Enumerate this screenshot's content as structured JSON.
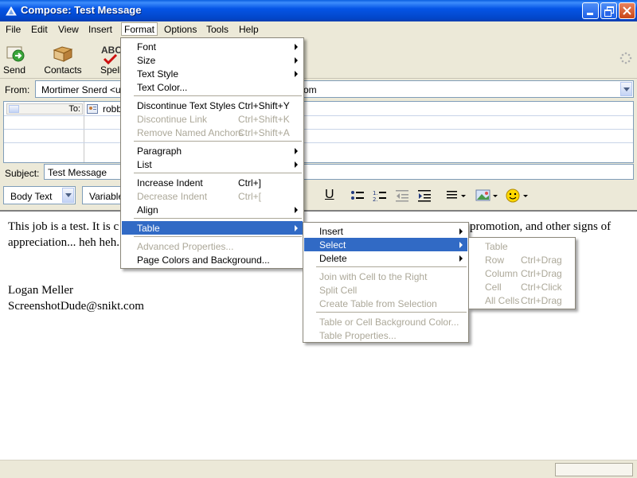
{
  "window": {
    "title": "Compose: Test Message"
  },
  "menubar": [
    "File",
    "Edit",
    "View",
    "Insert",
    "Format",
    "Options",
    "Tools",
    "Help"
  ],
  "toolbar": {
    "send": "Send",
    "contacts": "Contacts",
    "spell": "Spell",
    "spell_icon_text": "ABC"
  },
  "from": {
    "label": "From:",
    "value": "Mortimer Snerd <us",
    "value_tail": "om"
  },
  "to": {
    "label": "To:",
    "value": "robb"
  },
  "subject": {
    "label": "Subject:",
    "value": "Test Message"
  },
  "format_bar": {
    "paragraph_style": "Body Text",
    "font": "Variable",
    "underline": "U"
  },
  "body_lines": [
    "This job is a test.  It is c",
    "appreciation... heh heh.",
    "Logan Meller",
    "ScreenshotDude@snikt.com"
  ],
  "body_right": "promotion, and other signs of",
  "format_menu": [
    {
      "label": "Font",
      "submenu": true
    },
    {
      "label": "Size",
      "submenu": true
    },
    {
      "label": "Text Style",
      "submenu": true
    },
    {
      "label": "Text Color...",
      "submenu": false
    },
    {
      "label": "Discontinue Text Styles",
      "shortcut": "Ctrl+Shift+Y"
    },
    {
      "label": "Discontinue Link",
      "shortcut": "Ctrl+Shift+K",
      "disabled": true
    },
    {
      "label": "Remove Named Anchors",
      "shortcut": "Ctrl+Shift+A",
      "disabled": true
    },
    {
      "label": "Paragraph",
      "submenu": true
    },
    {
      "label": "List",
      "submenu": true
    },
    {
      "label": "Increase Indent",
      "shortcut": "Ctrl+]"
    },
    {
      "label": "Decrease Indent",
      "shortcut": "Ctrl+[",
      "disabled": true
    },
    {
      "label": "Align",
      "submenu": true
    },
    {
      "label": "Table",
      "submenu": true,
      "highlighted": true
    },
    {
      "label": "Advanced Properties...",
      "disabled": true
    },
    {
      "label": "Page Colors and Background..."
    }
  ],
  "table_menu": [
    {
      "label": "Insert",
      "submenu": true
    },
    {
      "label": "Select",
      "submenu": true,
      "highlighted": true
    },
    {
      "label": "Delete",
      "submenu": true
    },
    {
      "label": "Join with Cell to the Right",
      "disabled": true
    },
    {
      "label": "Split Cell",
      "disabled": true
    },
    {
      "label": "Create Table from Selection",
      "disabled": true
    },
    {
      "label": "Table or Cell Background Color...",
      "disabled": true
    },
    {
      "label": "Table Properties...",
      "disabled": true
    }
  ],
  "select_menu": [
    {
      "label": "Table",
      "shortcut": ""
    },
    {
      "label": "Row",
      "shortcut": "Ctrl+Drag"
    },
    {
      "label": "Column",
      "shortcut": "Ctrl+Drag"
    },
    {
      "label": "Cell",
      "shortcut": "Ctrl+Click"
    },
    {
      "label": "All Cells",
      "shortcut": "Ctrl+Drag"
    }
  ]
}
